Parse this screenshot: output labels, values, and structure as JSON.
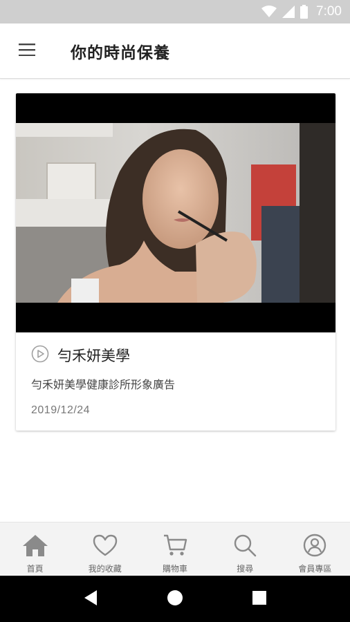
{
  "status_bar": {
    "time": "7:00"
  },
  "app_bar": {
    "title": "你的時尚保養"
  },
  "card": {
    "title": "勻禾妍美學",
    "description": "勻禾妍美學健康診所形象廣告",
    "date": "2019/12/24"
  },
  "bottom_nav": {
    "items": [
      {
        "label": "首頁",
        "icon": "home-icon"
      },
      {
        "label": "我的收藏",
        "icon": "heart-icon"
      },
      {
        "label": "購物車",
        "icon": "cart-icon"
      },
      {
        "label": "搜尋",
        "icon": "search-icon"
      },
      {
        "label": "會員專區",
        "icon": "user-icon"
      }
    ]
  },
  "colors": {
    "status_bar_bg": "#cfcfcf",
    "icon_gray": "#8a8a8a",
    "nav_bg": "#f3f3f3"
  }
}
